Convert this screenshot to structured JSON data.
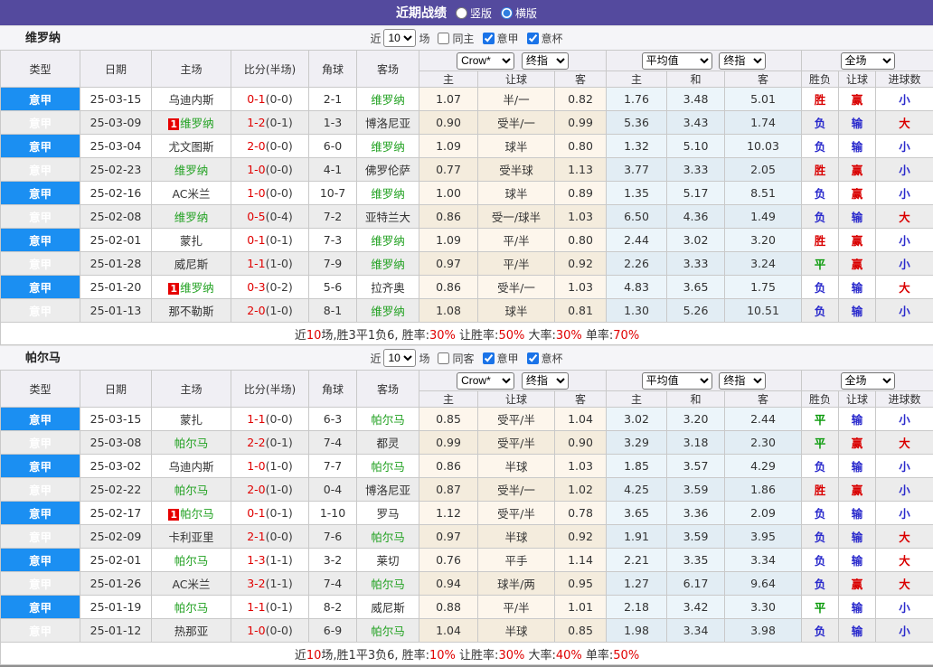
{
  "topbar": {
    "title": "近期战绩",
    "radios": [
      {
        "label": "竖版",
        "checked": false
      },
      {
        "label": "横版",
        "checked": true
      }
    ]
  },
  "table_headers": {
    "type": "类型",
    "date": "日期",
    "home": "主场",
    "score": "比分(半场)",
    "corner": "角球",
    "away": "客场",
    "odds_home": "主",
    "odds_handicap": "让球",
    "odds_away": "客",
    "avg_home": "主",
    "avg_draw": "和",
    "avg_away": "客",
    "result_wdl": "胜负",
    "result_handicap": "让球",
    "result_goals": "进球数"
  },
  "result_colors": {
    "胜": "#d90000",
    "平": "#0a9a0a",
    "负": "#2a2acc",
    "赢": "#d90000",
    "输": "#2a2acc",
    "大": "#d90000",
    "小": "#2a2acc"
  },
  "sections": [
    {
      "team": "维罗纳",
      "filter": {
        "near": "近",
        "count": "10",
        "games": "场",
        "same": "同主",
        "same_checked": false,
        "league": "意甲",
        "league_checked": true,
        "cup": "意杯",
        "cup_checked": true
      },
      "selects": {
        "odds_source": "Crow*",
        "odds_final": "终指",
        "avg_source": "平均值",
        "avg_final": "终指",
        "scope": "全场"
      },
      "rows": [
        {
          "league": "意甲",
          "date": "25-03-15",
          "home": {
            "name": "乌迪内斯"
          },
          "score": {
            "ft": "0-1",
            "ht": "(0-0)"
          },
          "corner": "2-1",
          "away": {
            "name": "维罗纳",
            "green": true
          },
          "odds": [
            "1.07",
            "半/一",
            "0.82"
          ],
          "avg": [
            "1.76",
            "3.48",
            "5.01"
          ],
          "results": [
            "胜",
            "赢",
            "小"
          ]
        },
        {
          "league": "意甲",
          "date": "25-03-09",
          "home": {
            "name": "维罗纳",
            "green": true,
            "badge": "1"
          },
          "score": {
            "ft": "1-2",
            "ht": "(0-1)"
          },
          "corner": "1-3",
          "away": {
            "name": "博洛尼亚"
          },
          "odds": [
            "0.90",
            "受半/一",
            "0.99"
          ],
          "avg": [
            "5.36",
            "3.43",
            "1.74"
          ],
          "results": [
            "负",
            "输",
            "大"
          ]
        },
        {
          "league": "意甲",
          "date": "25-03-04",
          "home": {
            "name": "尤文图斯"
          },
          "score": {
            "ft": "2-0",
            "ht": "(0-0)"
          },
          "corner": "6-0",
          "away": {
            "name": "维罗纳",
            "green": true
          },
          "odds": [
            "1.09",
            "球半",
            "0.80"
          ],
          "avg": [
            "1.32",
            "5.10",
            "10.03"
          ],
          "results": [
            "负",
            "输",
            "小"
          ]
        },
        {
          "league": "意甲",
          "date": "25-02-23",
          "home": {
            "name": "维罗纳",
            "green": true
          },
          "score": {
            "ft": "1-0",
            "ht": "(0-0)"
          },
          "corner": "4-1",
          "away": {
            "name": "佛罗伦萨"
          },
          "odds": [
            "0.77",
            "受半球",
            "1.13"
          ],
          "avg": [
            "3.77",
            "3.33",
            "2.05"
          ],
          "results": [
            "胜",
            "赢",
            "小"
          ]
        },
        {
          "league": "意甲",
          "date": "25-02-16",
          "home": {
            "name": "AC米兰"
          },
          "score": {
            "ft": "1-0",
            "ht": "(0-0)"
          },
          "corner": "10-7",
          "away": {
            "name": "维罗纳",
            "green": true
          },
          "odds": [
            "1.00",
            "球半",
            "0.89"
          ],
          "avg": [
            "1.35",
            "5.17",
            "8.51"
          ],
          "results": [
            "负",
            "赢",
            "小"
          ]
        },
        {
          "league": "意甲",
          "date": "25-02-08",
          "home": {
            "name": "维罗纳",
            "green": true
          },
          "score": {
            "ft": "0-5",
            "ht": "(0-4)"
          },
          "corner": "7-2",
          "away": {
            "name": "亚特兰大"
          },
          "odds": [
            "0.86",
            "受一/球半",
            "1.03"
          ],
          "avg": [
            "6.50",
            "4.36",
            "1.49"
          ],
          "results": [
            "负",
            "输",
            "大"
          ]
        },
        {
          "league": "意甲",
          "date": "25-02-01",
          "home": {
            "name": "蒙扎"
          },
          "score": {
            "ft": "0-1",
            "ht": "(0-1)"
          },
          "corner": "7-3",
          "away": {
            "name": "维罗纳",
            "green": true
          },
          "odds": [
            "1.09",
            "平/半",
            "0.80"
          ],
          "avg": [
            "2.44",
            "3.02",
            "3.20"
          ],
          "results": [
            "胜",
            "赢",
            "小"
          ]
        },
        {
          "league": "意甲",
          "date": "25-01-28",
          "home": {
            "name": "威尼斯"
          },
          "score": {
            "ft": "1-1",
            "ht": "(1-0)"
          },
          "corner": "7-9",
          "away": {
            "name": "维罗纳",
            "green": true
          },
          "odds": [
            "0.97",
            "平/半",
            "0.92"
          ],
          "avg": [
            "2.26",
            "3.33",
            "3.24"
          ],
          "results": [
            "平",
            "赢",
            "小"
          ]
        },
        {
          "league": "意甲",
          "date": "25-01-20",
          "home": {
            "name": "维罗纳",
            "green": true,
            "badge": "1"
          },
          "score": {
            "ft": "0-3",
            "ht": "(0-2)"
          },
          "corner": "5-6",
          "away": {
            "name": "拉齐奥"
          },
          "odds": [
            "0.86",
            "受半/一",
            "1.03"
          ],
          "avg": [
            "4.83",
            "3.65",
            "1.75"
          ],
          "results": [
            "负",
            "输",
            "大"
          ]
        },
        {
          "league": "意甲",
          "date": "25-01-13",
          "home": {
            "name": "那不勒斯"
          },
          "score": {
            "ft": "2-0",
            "ht": "(1-0)"
          },
          "corner": "8-1",
          "away": {
            "name": "维罗纳",
            "green": true
          },
          "odds": [
            "1.08",
            "球半",
            "0.81"
          ],
          "avg": [
            "1.30",
            "5.26",
            "10.51"
          ],
          "results": [
            "负",
            "输",
            "小"
          ]
        }
      ],
      "summary": [
        {
          "t": "近"
        },
        {
          "t": "10",
          "red": true
        },
        {
          "t": "场,胜3平1负6, 胜率:"
        },
        {
          "t": "30%",
          "red": true
        },
        {
          "t": " 让胜率:"
        },
        {
          "t": "50%",
          "red": true
        },
        {
          "t": " 大率:"
        },
        {
          "t": "30%",
          "red": true
        },
        {
          "t": " 单率:"
        },
        {
          "t": "70%",
          "red": true
        }
      ]
    },
    {
      "team": "帕尔马",
      "filter": {
        "near": "近",
        "count": "10",
        "games": "场",
        "same": "同客",
        "same_checked": false,
        "league": "意甲",
        "league_checked": true,
        "cup": "意杯",
        "cup_checked": true
      },
      "selects": {
        "odds_source": "Crow*",
        "odds_final": "终指",
        "avg_source": "平均值",
        "avg_final": "终指",
        "scope": "全场"
      },
      "rows": [
        {
          "league": "意甲",
          "date": "25-03-15",
          "home": {
            "name": "蒙扎"
          },
          "score": {
            "ft": "1-1",
            "ht": "(0-0)"
          },
          "corner": "6-3",
          "away": {
            "name": "帕尔马",
            "green": true
          },
          "odds": [
            "0.85",
            "受平/半",
            "1.04"
          ],
          "avg": [
            "3.02",
            "3.20",
            "2.44"
          ],
          "results": [
            "平",
            "输",
            "小"
          ]
        },
        {
          "league": "意甲",
          "date": "25-03-08",
          "home": {
            "name": "帕尔马",
            "green": true
          },
          "score": {
            "ft": "2-2",
            "ht": "(0-1)"
          },
          "corner": "7-4",
          "away": {
            "name": "都灵"
          },
          "odds": [
            "0.99",
            "受平/半",
            "0.90"
          ],
          "avg": [
            "3.29",
            "3.18",
            "2.30"
          ],
          "results": [
            "平",
            "赢",
            "大"
          ]
        },
        {
          "league": "意甲",
          "date": "25-03-02",
          "home": {
            "name": "乌迪内斯"
          },
          "score": {
            "ft": "1-0",
            "ht": "(1-0)"
          },
          "corner": "7-7",
          "away": {
            "name": "帕尔马",
            "green": true
          },
          "odds": [
            "0.86",
            "半球",
            "1.03"
          ],
          "avg": [
            "1.85",
            "3.57",
            "4.29"
          ],
          "results": [
            "负",
            "输",
            "小"
          ]
        },
        {
          "league": "意甲",
          "date": "25-02-22",
          "home": {
            "name": "帕尔马",
            "green": true
          },
          "score": {
            "ft": "2-0",
            "ht": "(1-0)"
          },
          "corner": "0-4",
          "away": {
            "name": "博洛尼亚"
          },
          "odds": [
            "0.87",
            "受半/一",
            "1.02"
          ],
          "avg": [
            "4.25",
            "3.59",
            "1.86"
          ],
          "results": [
            "胜",
            "赢",
            "小"
          ]
        },
        {
          "league": "意甲",
          "date": "25-02-17",
          "home": {
            "name": "帕尔马",
            "green": true,
            "badge": "1"
          },
          "score": {
            "ft": "0-1",
            "ht": "(0-1)"
          },
          "corner": "1-10",
          "away": {
            "name": "罗马"
          },
          "odds": [
            "1.12",
            "受平/半",
            "0.78"
          ],
          "avg": [
            "3.65",
            "3.36",
            "2.09"
          ],
          "results": [
            "负",
            "输",
            "小"
          ]
        },
        {
          "league": "意甲",
          "date": "25-02-09",
          "home": {
            "name": "卡利亚里"
          },
          "score": {
            "ft": "2-1",
            "ht": "(0-0)"
          },
          "corner": "7-6",
          "away": {
            "name": "帕尔马",
            "green": true
          },
          "odds": [
            "0.97",
            "半球",
            "0.92"
          ],
          "avg": [
            "1.91",
            "3.59",
            "3.95"
          ],
          "results": [
            "负",
            "输",
            "大"
          ]
        },
        {
          "league": "意甲",
          "date": "25-02-01",
          "home": {
            "name": "帕尔马",
            "green": true
          },
          "score": {
            "ft": "1-3",
            "ht": "(1-1)"
          },
          "corner": "3-2",
          "away": {
            "name": "莱切"
          },
          "odds": [
            "0.76",
            "平手",
            "1.14"
          ],
          "avg": [
            "2.21",
            "3.35",
            "3.34"
          ],
          "results": [
            "负",
            "输",
            "大"
          ]
        },
        {
          "league": "意甲",
          "date": "25-01-26",
          "home": {
            "name": "AC米兰"
          },
          "score": {
            "ft": "3-2",
            "ht": "(1-1)"
          },
          "corner": "7-4",
          "away": {
            "name": "帕尔马",
            "green": true
          },
          "odds": [
            "0.94",
            "球半/两",
            "0.95"
          ],
          "avg": [
            "1.27",
            "6.17",
            "9.64"
          ],
          "results": [
            "负",
            "赢",
            "大"
          ]
        },
        {
          "league": "意甲",
          "date": "25-01-19",
          "home": {
            "name": "帕尔马",
            "green": true
          },
          "score": {
            "ft": "1-1",
            "ht": "(0-1)"
          },
          "corner": "8-2",
          "away": {
            "name": "威尼斯"
          },
          "odds": [
            "0.88",
            "平/半",
            "1.01"
          ],
          "avg": [
            "2.18",
            "3.42",
            "3.30"
          ],
          "results": [
            "平",
            "输",
            "小"
          ]
        },
        {
          "league": "意甲",
          "date": "25-01-12",
          "home": {
            "name": "热那亚"
          },
          "score": {
            "ft": "1-0",
            "ht": "(0-0)"
          },
          "corner": "6-9",
          "away": {
            "name": "帕尔马",
            "green": true
          },
          "odds": [
            "1.04",
            "半球",
            "0.85"
          ],
          "avg": [
            "1.98",
            "3.34",
            "3.98"
          ],
          "results": [
            "负",
            "输",
            "小"
          ]
        }
      ],
      "summary": [
        {
          "t": "近"
        },
        {
          "t": "10",
          "red": true
        },
        {
          "t": "场,胜1平3负6, 胜率:"
        },
        {
          "t": "10%",
          "red": true
        },
        {
          "t": " 让胜率:"
        },
        {
          "t": "30%",
          "red": true
        },
        {
          "t": " 大率:"
        },
        {
          "t": "40%",
          "red": true
        },
        {
          "t": " 单率:"
        },
        {
          "t": "50%",
          "red": true
        }
      ]
    }
  ]
}
